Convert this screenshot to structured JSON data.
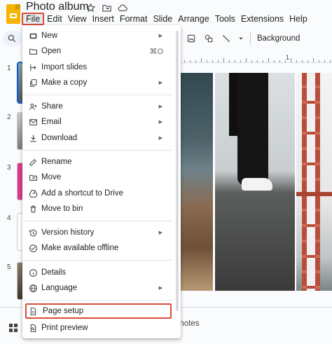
{
  "app": {
    "title": "Photo album",
    "title_icons": [
      "star-icon",
      "move-to-folder-icon",
      "cloud-saved-icon"
    ]
  },
  "menubar": [
    "File",
    "Edit",
    "View",
    "Insert",
    "Format",
    "Slide",
    "Arrange",
    "Tools",
    "Extensions",
    "Help"
  ],
  "toolbar": {
    "background_label": "Background",
    "icons": [
      "select-icon",
      "image-icon",
      "shapes-icon",
      "line-icon",
      "chevron-down-icon"
    ]
  },
  "ruler": {
    "labels": [
      "1"
    ]
  },
  "filmstrip": {
    "slide_numbers": [
      "1",
      "2",
      "3",
      "4",
      "5"
    ]
  },
  "notes_label": "er notes",
  "file_menu": {
    "items": [
      {
        "label": "New",
        "icon": "new-slides-icon",
        "submenu": true
      },
      {
        "label": "Open",
        "icon": "open-folder-icon",
        "shortcut": "⌘O"
      },
      {
        "label": "Import slides",
        "icon": "import-icon"
      },
      {
        "label": "Make a copy",
        "icon": "copy-icon",
        "submenu": true
      },
      {
        "label": "Share",
        "icon": "share-person-icon",
        "submenu": true
      },
      {
        "label": "Email",
        "icon": "email-icon",
        "submenu": true
      },
      {
        "label": "Download",
        "icon": "download-icon",
        "submenu": true
      },
      {
        "label": "Rename",
        "icon": "rename-icon"
      },
      {
        "label": "Move",
        "icon": "move-folder-icon"
      },
      {
        "label": "Add a shortcut to Drive",
        "icon": "drive-shortcut-icon"
      },
      {
        "label": "Move to bin",
        "icon": "trash-icon"
      },
      {
        "label": "Version history",
        "icon": "history-icon",
        "submenu": true
      },
      {
        "label": "Make available offline",
        "icon": "offline-icon"
      },
      {
        "label": "Details",
        "icon": "info-icon"
      },
      {
        "label": "Language",
        "icon": "globe-icon",
        "submenu": true
      },
      {
        "label": "Page setup",
        "icon": "page-setup-icon",
        "highlighted": true
      },
      {
        "label": "Print preview",
        "icon": "print-preview-icon"
      }
    ],
    "submenu_arrow": "▶"
  },
  "colors": {
    "highlight_border": "#d94b3a",
    "accent_blue": "#0b57d0",
    "logo_yellow": "#f4b400"
  }
}
